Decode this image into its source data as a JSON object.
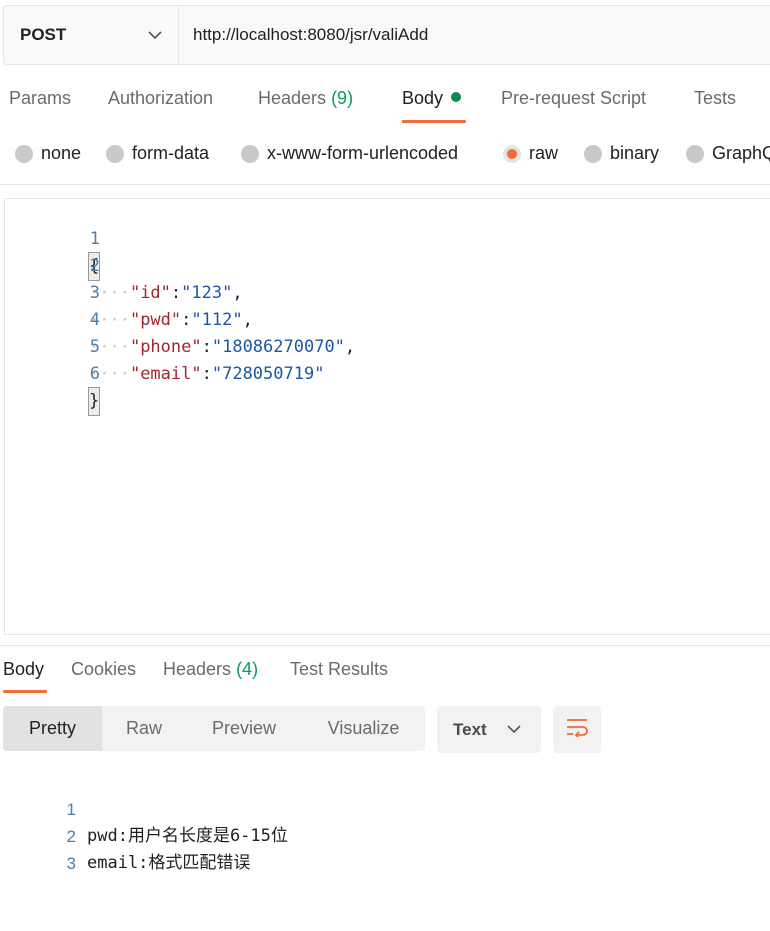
{
  "request": {
    "method": "POST",
    "url": "http://localhost:8080/jsr/valiAdd"
  },
  "request_tabs": {
    "params": "Params",
    "authorization": "Authorization",
    "headers_label": "Headers",
    "headers_count": "(9)",
    "body": "Body",
    "prerequest": "Pre-request Script",
    "tests": "Tests"
  },
  "body_types": {
    "none": "none",
    "form_data": "form-data",
    "urlencoded": "x-www-form-urlencoded",
    "raw": "raw",
    "binary": "binary",
    "graphql": "GraphQL",
    "selected": "raw"
  },
  "editor": {
    "lines": [
      {
        "num": "1",
        "dots": "",
        "key": "",
        "sep": "",
        "val": "",
        "end": "",
        "brace": "{"
      },
      {
        "num": "2",
        "dots": "····",
        "key": "\"id\"",
        "sep": ":",
        "val": "\"123\"",
        "end": ",",
        "brace": ""
      },
      {
        "num": "3",
        "dots": "····",
        "key": "\"pwd\"",
        "sep": ":",
        "val": "\"112\"",
        "end": ",",
        "brace": ""
      },
      {
        "num": "4",
        "dots": "····",
        "key": "\"phone\"",
        "sep": ":",
        "val": "\"18086270070\"",
        "end": ",",
        "brace": ""
      },
      {
        "num": "5",
        "dots": "····",
        "key": "\"email\"",
        "sep": ":",
        "val": "\"728050719\"",
        "end": "",
        "brace": ""
      },
      {
        "num": "6",
        "dots": "",
        "key": "",
        "sep": "",
        "val": "",
        "end": "",
        "brace": "}"
      }
    ]
  },
  "response_tabs": {
    "body": "Body",
    "cookies": "Cookies",
    "headers_label": "Headers",
    "headers_count": "(4)",
    "test_results": "Test Results"
  },
  "response_view": {
    "pretty": "Pretty",
    "raw": "Raw",
    "preview": "Preview",
    "visualize": "Visualize",
    "format": "Text"
  },
  "response_output": {
    "lines": [
      {
        "num": "1",
        "text": "pwd:用户名长度是6-15位"
      },
      {
        "num": "2",
        "text": "email:格式匹配错误"
      },
      {
        "num": "3",
        "text": ""
      }
    ]
  },
  "colors": {
    "accent": "#f26b3a",
    "success": "#0c9b56",
    "json_key": "#a1262f",
    "json_string": "#1e57a4",
    "line_number": "#4d7fa8"
  },
  "icons": {
    "method_dropdown": "chevron-down-icon",
    "format_dropdown": "chevron-down-icon",
    "wrap": "wrap-lines-icon"
  }
}
